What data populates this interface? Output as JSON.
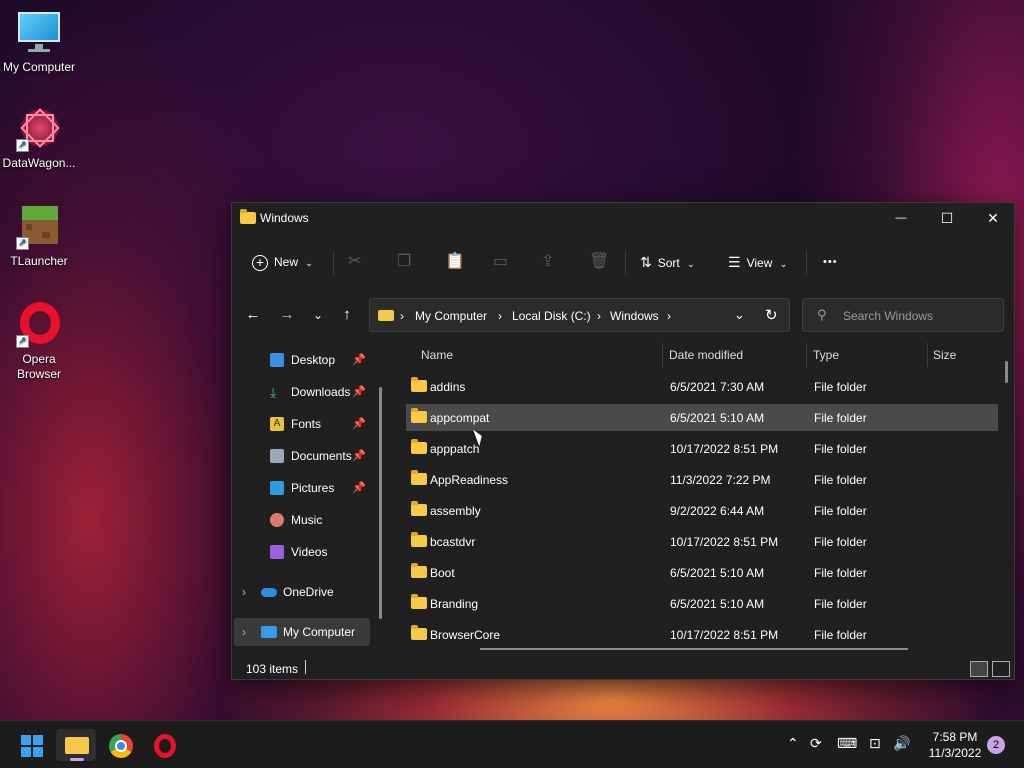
{
  "desktop": {
    "icons": [
      {
        "label": "My Computer"
      },
      {
        "label": "DataWagon..."
      },
      {
        "label": "TLauncher"
      },
      {
        "label": "Opera Browser"
      }
    ]
  },
  "window": {
    "title": "Windows",
    "controls": {
      "minimize": "—",
      "maximize": "☐",
      "close": "✕"
    }
  },
  "toolbar": {
    "new_label": "New",
    "sort_label": "Sort",
    "view_label": "View",
    "more_label": "•••"
  },
  "address": {
    "segments": [
      "My Computer",
      "Local Disk (C:)",
      "Windows"
    ]
  },
  "search": {
    "placeholder": "Search Windows"
  },
  "sidebar": {
    "items": [
      {
        "label": "Desktop",
        "pinned": true,
        "color": "#3b8ee8"
      },
      {
        "label": "Downloads",
        "pinned": true,
        "color": "#3ac07a"
      },
      {
        "label": "Fonts",
        "pinned": true,
        "color": "#e8c23b"
      },
      {
        "label": "Documents",
        "pinned": true,
        "color": "#9aa8b8"
      },
      {
        "label": "Pictures",
        "pinned": true,
        "color": "#2f9de0"
      },
      {
        "label": "Music",
        "pinned": false,
        "color": "#e07a6a"
      },
      {
        "label": "Videos",
        "pinned": false,
        "color": "#9a5fe0"
      },
      {
        "label": "OneDrive",
        "pinned": false,
        "color": "#2f8de0"
      },
      {
        "label": "My Computer",
        "pinned": false,
        "color": "#3b9ae8"
      }
    ]
  },
  "filelist": {
    "columns": [
      "Name",
      "Date modified",
      "Type",
      "Size"
    ],
    "rows": [
      {
        "name": "addins",
        "date": "6/5/2021 7:30 AM",
        "type": "File folder"
      },
      {
        "name": "appcompat",
        "date": "6/5/2021 5:10 AM",
        "type": "File folder"
      },
      {
        "name": "apppatch",
        "date": "10/17/2022 8:51 PM",
        "type": "File folder"
      },
      {
        "name": "AppReadiness",
        "date": "11/3/2022 7:22 PM",
        "type": "File folder"
      },
      {
        "name": "assembly",
        "date": "9/2/2022 6:44 AM",
        "type": "File folder"
      },
      {
        "name": "bcastdvr",
        "date": "10/17/2022 8:51 PM",
        "type": "File folder"
      },
      {
        "name": "Boot",
        "date": "6/5/2021 5:10 AM",
        "type": "File folder"
      },
      {
        "name": "Branding",
        "date": "6/5/2021 5:10 AM",
        "type": "File folder"
      },
      {
        "name": "BrowserCore",
        "date": "10/17/2022 8:51 PM",
        "type": "File folder"
      }
    ]
  },
  "status": {
    "item_count": "103 items"
  },
  "taskbar": {
    "time": "7:58 PM",
    "date": "11/3/2022",
    "notification_count": "2"
  }
}
